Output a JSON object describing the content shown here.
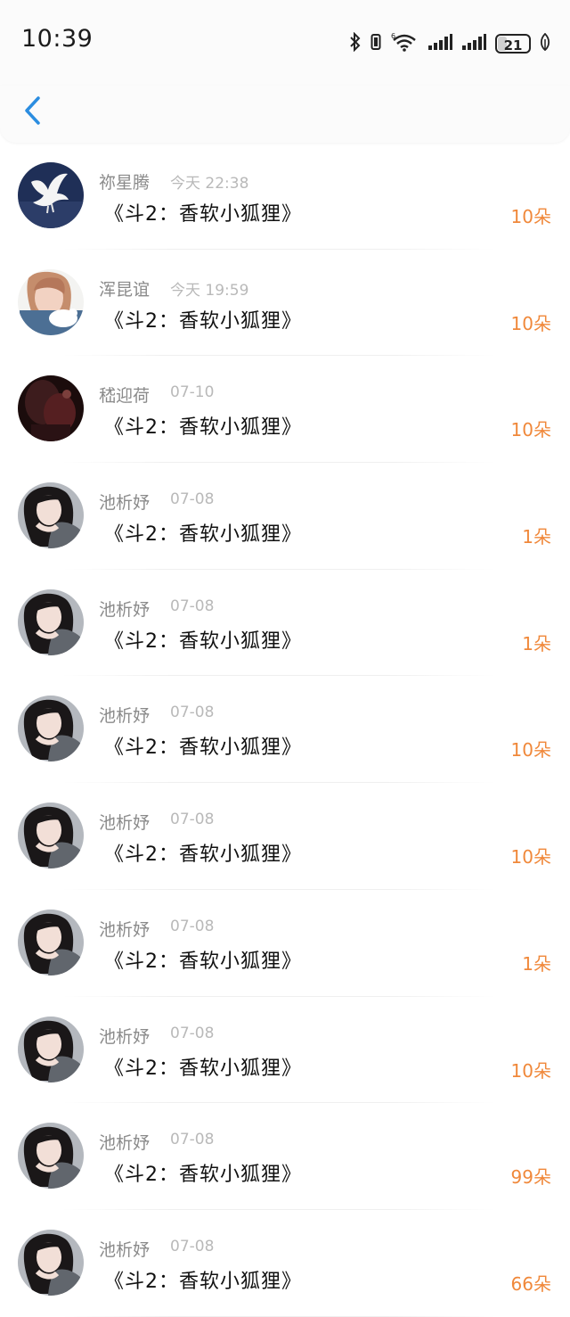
{
  "status_bar": {
    "time": "10:39",
    "battery": "21",
    "icons": [
      "bluetooth-icon",
      "vibrate-icon",
      "wifi-6-icon",
      "signal-icon",
      "signal-icon",
      "battery-icon",
      "leaf-icon"
    ]
  },
  "nav": {
    "back_icon": "chevron-left-icon",
    "accent": "#2b8de0"
  },
  "colors": {
    "count": "#f0883a",
    "name": "#8a8a8a",
    "timestamp": "#b9b9b9"
  },
  "rows": [
    {
      "name": "祢星腾",
      "time": "今天 22:38",
      "title": "《斗2：香软小狐狸》",
      "count": "10朵",
      "avatar": "dove-avatar"
    },
    {
      "name": "浑昆谊",
      "time": "今天 19:59",
      "title": "《斗2：香软小狐狸》",
      "count": "10朵",
      "avatar": "girl-with-bird-avatar"
    },
    {
      "name": "嵇迎荷",
      "time": "07-10",
      "title": "《斗2：香软小狐狸》",
      "count": "10朵",
      "avatar": "dark-room-avatar"
    },
    {
      "name": "池析妤",
      "time": "07-08",
      "title": "《斗2：香软小狐狸》",
      "count": "1朵",
      "avatar": "woman-portrait-avatar"
    },
    {
      "name": "池析妤",
      "time": "07-08",
      "title": "《斗2：香软小狐狸》",
      "count": "1朵",
      "avatar": "woman-portrait-avatar"
    },
    {
      "name": "池析妤",
      "time": "07-08",
      "title": "《斗2：香软小狐狸》",
      "count": "10朵",
      "avatar": "woman-portrait-avatar"
    },
    {
      "name": "池析妤",
      "time": "07-08",
      "title": "《斗2：香软小狐狸》",
      "count": "10朵",
      "avatar": "woman-portrait-avatar"
    },
    {
      "name": "池析妤",
      "time": "07-08",
      "title": "《斗2：香软小狐狸》",
      "count": "1朵",
      "avatar": "woman-portrait-avatar"
    },
    {
      "name": "池析妤",
      "time": "07-08",
      "title": "《斗2：香软小狐狸》",
      "count": "10朵",
      "avatar": "woman-portrait-avatar"
    },
    {
      "name": "池析妤",
      "time": "07-08",
      "title": "《斗2：香软小狐狸》",
      "count": "99朵",
      "avatar": "woman-portrait-avatar"
    },
    {
      "name": "池析妤",
      "time": "07-08",
      "title": "《斗2：香软小狐狸》",
      "count": "66朵",
      "avatar": "woman-portrait-avatar"
    }
  ]
}
